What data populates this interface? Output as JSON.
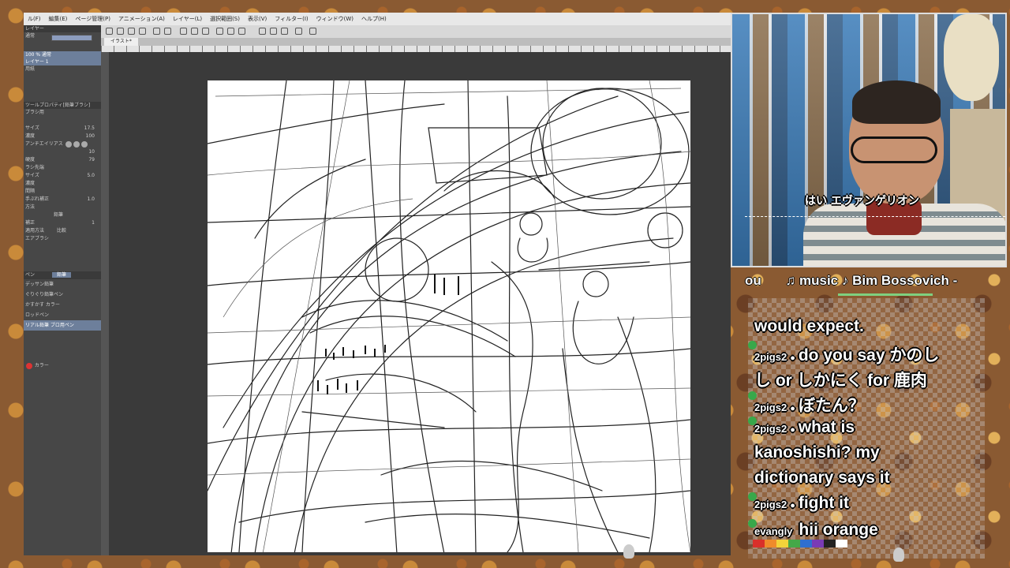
{
  "app": {
    "menu": [
      "ル(F)",
      "編集(E)",
      "ページ管理(P)",
      "アニメーション(A)",
      "レイヤー(L)",
      "選択範囲(S)",
      "表示(V)",
      "フィルター(I)",
      "ウィンドウ(W)",
      "ヘルプ(H)"
    ],
    "document_tab": "イラスト*"
  },
  "layer_panel": {
    "header": "レイヤー",
    "blend_mode": "通常",
    "opacity": "100",
    "layers": [
      {
        "name": "100 % 通常\nレイヤー 1",
        "selected": true
      },
      {
        "name": "用紙",
        "selected": false
      }
    ]
  },
  "tool_property": {
    "header": "ツールプロパティ[鉛筆ブラシ]",
    "brush_name": "ブラシ用",
    "rows": [
      {
        "label": "サイズ",
        "value": "17.5"
      },
      {
        "label": "濃度",
        "value": "100"
      },
      {
        "label": "アンチエイリアス",
        "value": ""
      },
      {
        "label": "",
        "value": "10"
      },
      {
        "label": "硬度",
        "value": "79"
      },
      {
        "label": "ラシ先端",
        "value": ""
      },
      {
        "label": "サイズ",
        "value": "5.0"
      },
      {
        "label": "濃度",
        "value": ""
      },
      {
        "label": "間隔",
        "value": ""
      },
      {
        "label": "手ぶれ補正",
        "value": "1.0"
      },
      {
        "label": "方法",
        "value": ""
      },
      {
        "label": "",
        "value": "鉛筆"
      },
      {
        "label": "補正",
        "value": "1"
      },
      {
        "label": "適用方法",
        "value": "比較"
      },
      {
        "label": "エアブラシ",
        "value": ""
      }
    ]
  },
  "brush_list": {
    "tabs": [
      "ペン",
      "鉛筆"
    ],
    "items": [
      "デッサン鉛筆",
      "ぐりぐり鉛筆ペン",
      "かすかす カラー",
      "ロッドペン",
      "リアル鉛筆 ブロ用ペン"
    ]
  },
  "color_panel": {
    "label": "カラー"
  },
  "stream": {
    "webcam_caption": "はい エヴァンゲリオン",
    "now_playing_prefix": "ou",
    "now_playing": "♫ music ♪ Bim Bossovich -"
  },
  "chat": [
    {
      "user": "",
      "text": "would expect."
    },
    {
      "user": "2pigs2",
      "text": "do you say かのし"
    },
    {
      "user": "",
      "text": "し or しかにく for 鹿肉"
    },
    {
      "user": "2pigs2",
      "text": "ぼたん？"
    },
    {
      "user": "2pigs2",
      "text": "what is"
    },
    {
      "user": "",
      "text": "kanoshishi? my"
    },
    {
      "user": "",
      "text": "dictionary says it"
    },
    {
      "user": "2pigs2",
      "text": "fight it"
    },
    {
      "user": "evangly",
      "text": "hii orange"
    }
  ],
  "colors": {
    "palette": [
      "#d9302a",
      "#ef8b2b",
      "#f2d33a",
      "#45a848",
      "#2f6fd0",
      "#7a3bb5",
      "#222222",
      "#ffffff"
    ]
  }
}
